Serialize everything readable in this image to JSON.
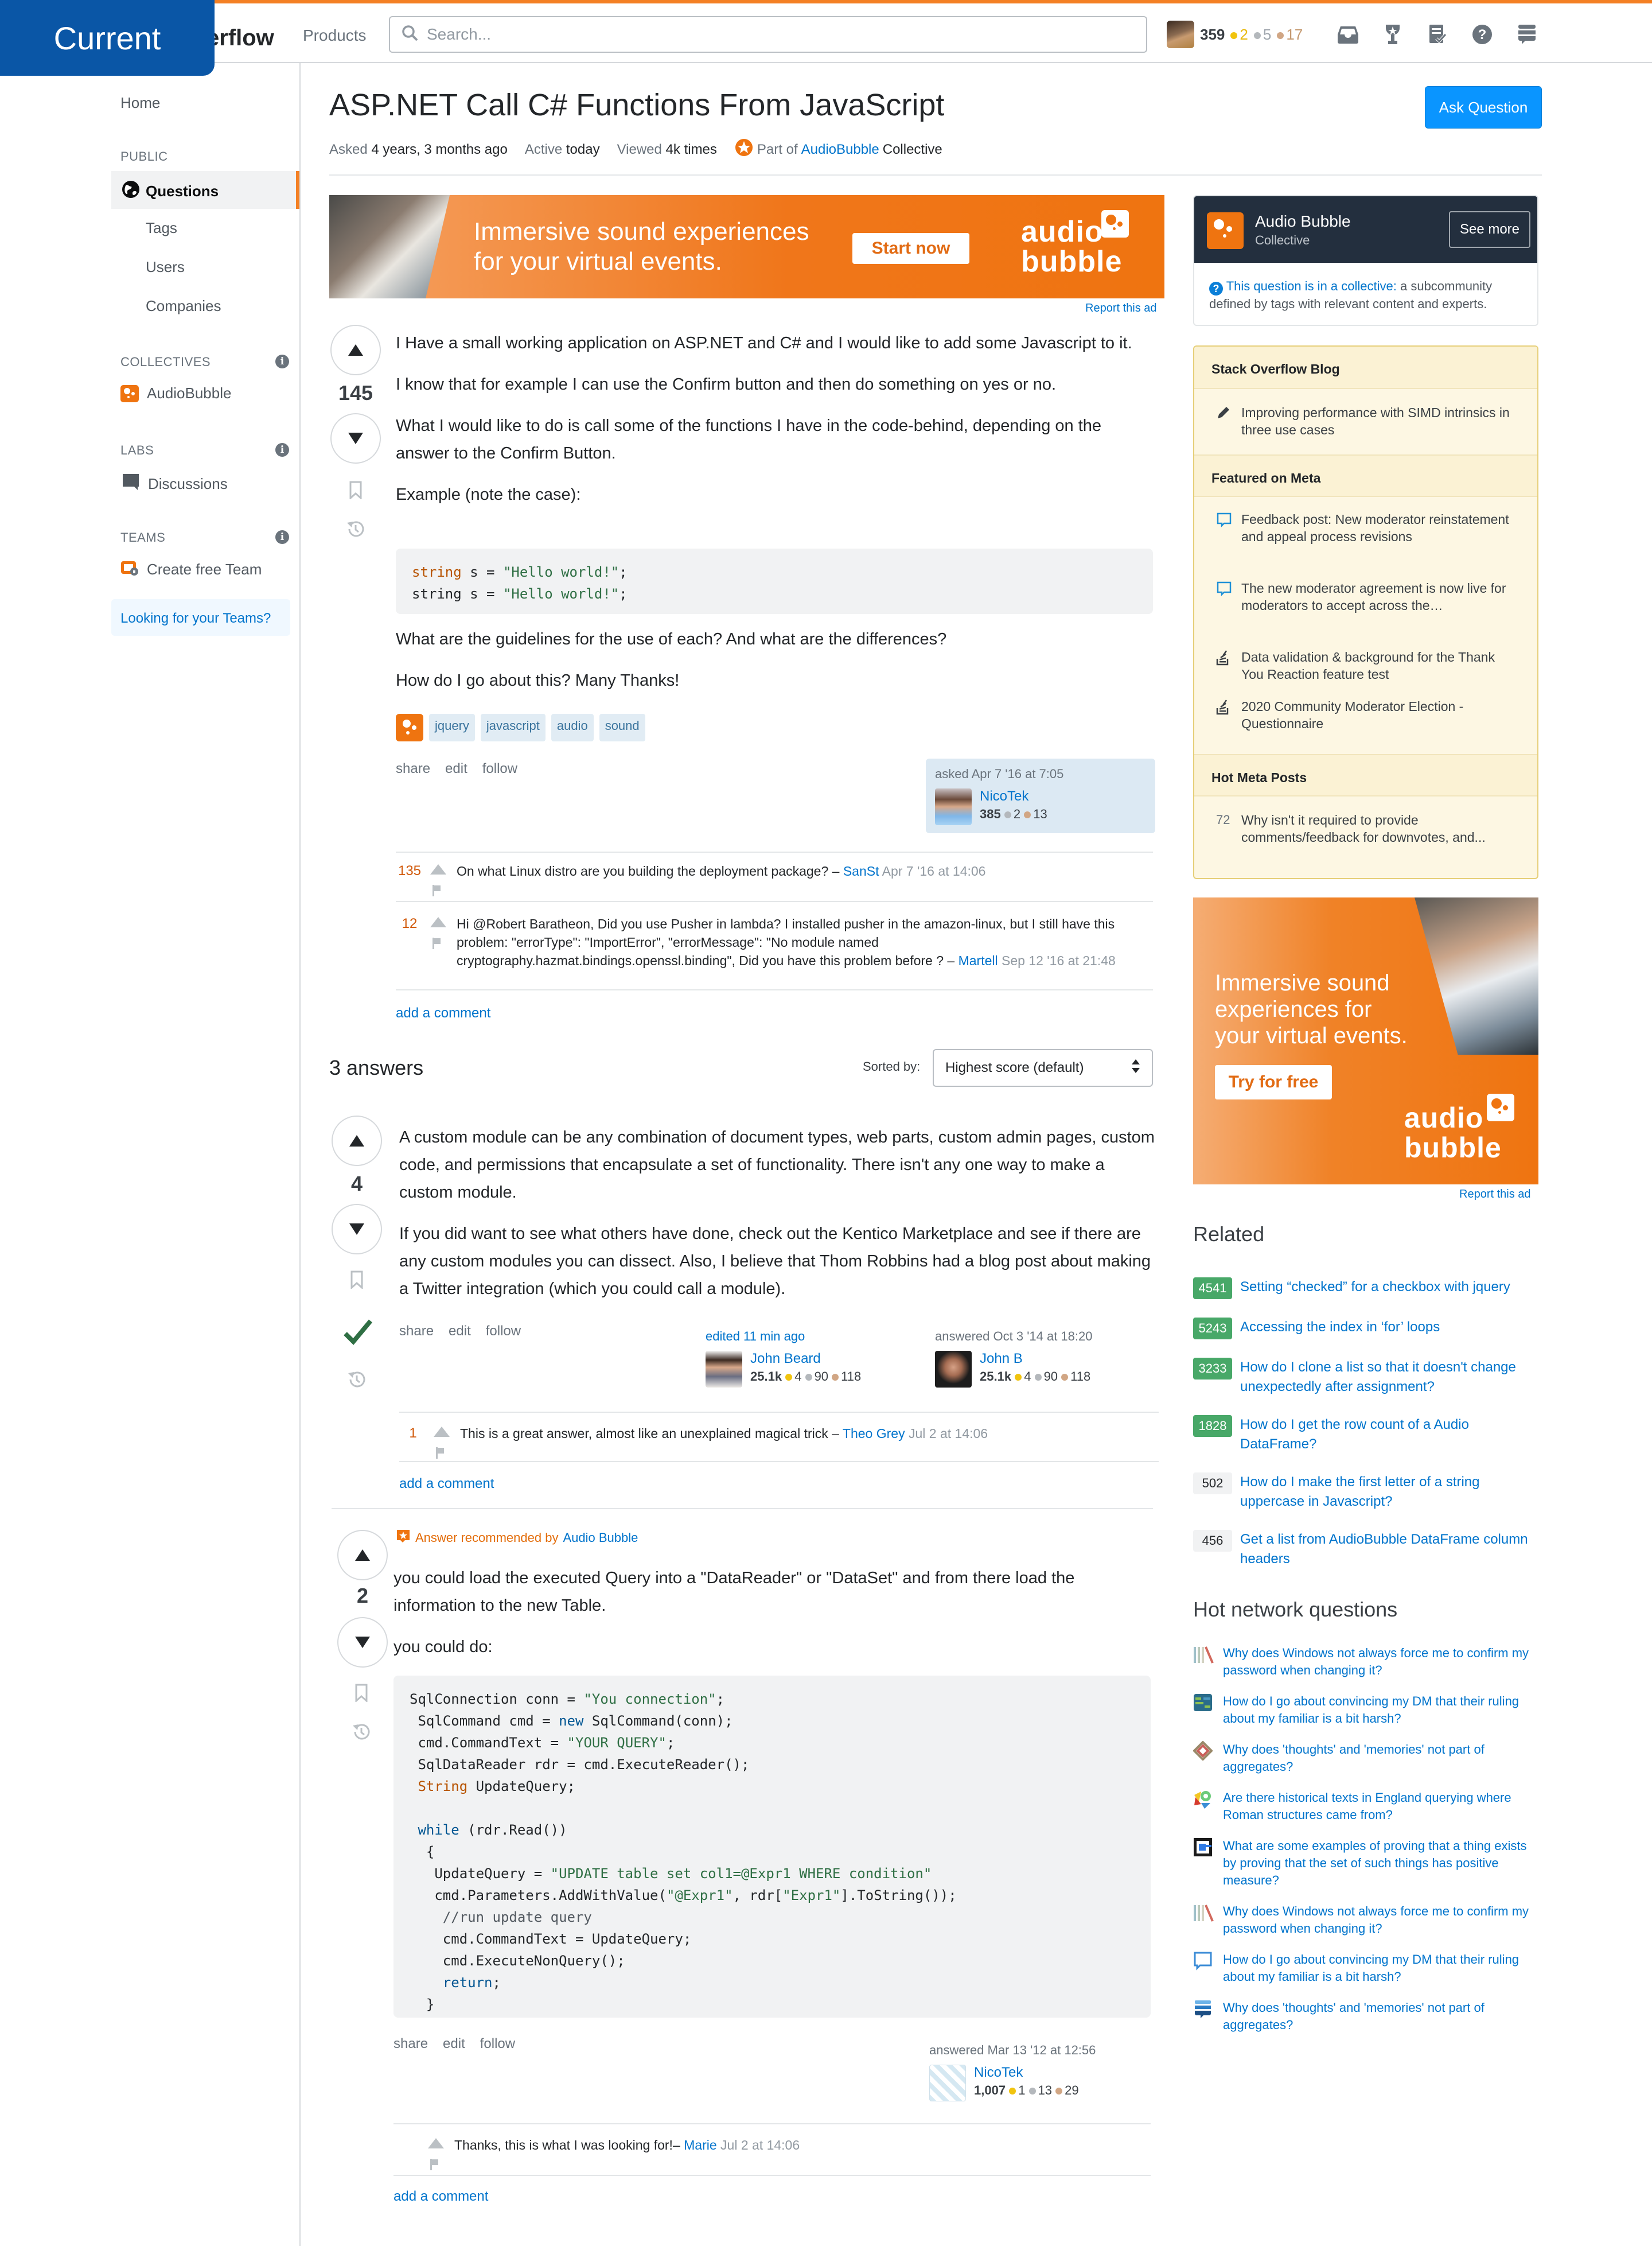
{
  "overlay_badge": "Current",
  "topbar": {
    "logo_text": "erflow",
    "products": "Products",
    "search_placeholder": "Search...",
    "user": {
      "reputation": "359",
      "gold": "2",
      "silver": "5",
      "bronze": "17"
    },
    "icons": [
      "inbox-icon",
      "achievements-icon",
      "review-icon",
      "help-icon",
      "site-switcher-icon"
    ]
  },
  "sidebar": {
    "home": "Home",
    "public_label": "PUBLIC",
    "items": [
      {
        "label": "Questions",
        "active": true
      },
      {
        "label": "Tags"
      },
      {
        "label": "Users"
      },
      {
        "label": "Companies"
      }
    ],
    "collectives_label": "COLLECTIVES",
    "collective_item": "AudioBubble",
    "labs_label": "LABS",
    "labs_item": "Discussions",
    "teams_label": "TEAMS",
    "teams_item": "Create free Team",
    "teams_box": "Looking for your Teams?"
  },
  "question": {
    "title": "ASP.NET Call C# Functions From JavaScript",
    "ask_button": "Ask Question",
    "meta": {
      "asked_label": "Asked",
      "asked_value": "4 years, 3 months ago",
      "active_label": "Active",
      "active_value": "today",
      "viewed_label": "Viewed",
      "viewed_value": "4k times",
      "part_of": "Part of",
      "collective_link": "AudioBubble",
      "collective_suffix": "Collective"
    },
    "score": "145",
    "paragraphs": [
      "I Have a small working application on ASP.NET and C# and I would like to add some Javascript to it.",
      "I know that for example I can use the Confirm button and then do something on yes or no.",
      "What I would like to do is call some of the functions I have in the code-behind, depending on the answer to the Confirm Button.",
      "Example (note the case):"
    ],
    "code_lines": [
      [
        {
          "t": "string",
          "c": "type"
        },
        {
          "t": " s = ",
          "c": ""
        },
        {
          "t": "\"Hello world!\"",
          "c": "str"
        },
        {
          "t": ";",
          "c": ""
        }
      ],
      [
        {
          "t": "string s = ",
          "c": ""
        },
        {
          "t": "\"Hello world!\"",
          "c": "str"
        },
        {
          "t": ";",
          "c": ""
        }
      ]
    ],
    "paragraphs_after": [
      "What are the guidelines for the use of each? And what are the differences?",
      "How do I go about this? Many Thanks!"
    ],
    "tags": [
      "jquery",
      "javascript",
      "audio",
      "sound"
    ],
    "menu": [
      "share",
      "edit",
      "follow"
    ],
    "owner": {
      "when": "asked Apr 7 '16 at 7:05",
      "name": "NicoTek",
      "rep": "385",
      "silver": "2",
      "bronze": "13"
    },
    "comments": [
      {
        "score": "135",
        "text": "On what Linux distro are you building the deployment package? –",
        "user": "SanSt",
        "date": "Apr 7 '16 at 14:06"
      },
      {
        "score": "12",
        "text": "Hi @Robert Baratheon, Did you use Pusher in lambda? I installed pusher in the amazon-linux, but I still have this problem: \"errorType\": \"ImportError\",   \"errorMessage\": \"No module named cryptography.hazmat.bindings.openssl.binding\", Did you have this problem before ? –",
        "user": "Martell",
        "date": "Sep 12 '16 at 21:48"
      }
    ],
    "add_comment": "add a comment"
  },
  "answers_header": {
    "count": "3 answers",
    "sorted_by": "Sorted by:",
    "sort_value": "Highest score (default)"
  },
  "answers": [
    {
      "score": "4",
      "accepted": true,
      "paragraphs": [
        "A custom module can be any combination of document types, web parts, custom admin pages, custom code, and permissions that encapsulate a set of functionality. There isn't any one way to make a custom module.",
        "If you did want to see what others have done, check out the Kentico Marketplace and see if there are any custom modules you can dissect. Also, I believe that Thom Robbins had a blog post about making a Twitter integration (which you could call a module)."
      ],
      "menu": [
        "share",
        "edit",
        "follow"
      ],
      "editor": {
        "when": "edited 11 min ago",
        "name": "John Beard",
        "rep": "25.1k",
        "gold": "4",
        "silver": "90",
        "bronze": "118"
      },
      "author": {
        "when": "answered Oct 3 '14 at 18:20",
        "name": "John B",
        "rep": "25.1k",
        "gold": "4",
        "silver": "90",
        "bronze": "118"
      },
      "comments": [
        {
          "score": "1",
          "text": "This is a great answer, almost like an unexplained magical trick –",
          "user": "Theo Grey",
          "date": "Jul 2 at 14:06"
        }
      ],
      "add_comment": "add a comment"
    },
    {
      "score": "2",
      "recommended_label": "Answer recommended by",
      "recommended_by": "Audio Bubble",
      "paragraphs": [
        "you could load the executed Query into a \"DataReader\" or \"DataSet\" and from there load the information to the new Table.",
        "you could do:"
      ],
      "code_lines": [
        [
          {
            "t": "SqlConnection conn = ",
            "c": ""
          },
          {
            "t": "\"You connection\"",
            "c": "str"
          },
          {
            "t": ";",
            "c": ""
          }
        ],
        [
          {
            "t": " SqlCommand cmd = ",
            "c": ""
          },
          {
            "t": "new",
            "c": "key"
          },
          {
            "t": " SqlCommand(conn);",
            "c": ""
          }
        ],
        [
          {
            "t": " cmd.CommandText = ",
            "c": ""
          },
          {
            "t": "\"YOUR QUERY\"",
            "c": "str"
          },
          {
            "t": ";",
            "c": ""
          }
        ],
        [
          {
            "t": " SqlDataReader rdr = cmd.ExecuteReader();",
            "c": ""
          }
        ],
        [
          {
            "t": " ",
            "c": ""
          },
          {
            "t": "String",
            "c": "type"
          },
          {
            "t": " UpdateQuery;",
            "c": ""
          }
        ],
        [
          {
            "t": "",
            "c": ""
          }
        ],
        [
          {
            "t": " ",
            "c": ""
          },
          {
            "t": "while",
            "c": "key"
          },
          {
            "t": " (rdr.Read())",
            "c": ""
          }
        ],
        [
          {
            "t": "  {",
            "c": ""
          }
        ],
        [
          {
            "t": "   UpdateQuery = ",
            "c": ""
          },
          {
            "t": "\"UPDATE table set col1=@Expr1 WHERE condition\"",
            "c": "str"
          }
        ],
        [
          {
            "t": "   cmd.Parameters.AddWithValue(",
            "c": ""
          },
          {
            "t": "\"@Expr1\"",
            "c": "str"
          },
          {
            "t": ", rdr[",
            "c": ""
          },
          {
            "t": "\"Expr1\"",
            "c": "str"
          },
          {
            "t": "].ToString());",
            "c": ""
          }
        ],
        [
          {
            "t": "    //run update query",
            "c": "com"
          }
        ],
        [
          {
            "t": "    cmd.CommandText = UpdateQuery;",
            "c": ""
          }
        ],
        [
          {
            "t": "    cmd.ExecuteNonQuery();",
            "c": ""
          }
        ],
        [
          {
            "t": "    ",
            "c": ""
          },
          {
            "t": "return",
            "c": "key"
          },
          {
            "t": ";",
            "c": ""
          }
        ],
        [
          {
            "t": "  }",
            "c": ""
          }
        ]
      ],
      "menu": [
        "share",
        "edit",
        "follow"
      ],
      "author": {
        "when": "answered Mar 13 '12 at 12:56",
        "name": "NicoTek",
        "rep": "1,007",
        "gold": "1",
        "silver": "13",
        "bronze": "29"
      },
      "comments": [
        {
          "score": "",
          "text": "Thanks, this is what I was looking for!–",
          "user": "Marie",
          "date": "Jul 2 at 14:06"
        }
      ],
      "add_comment": "add a comment"
    }
  ],
  "ads": {
    "banner": {
      "headline_1": "Immersive sound experiences",
      "headline_2": "for your virtual events.",
      "cta": "Start now",
      "brand_1": "audio",
      "brand_2": "bubble",
      "report": "Report this ad"
    },
    "square": {
      "headline_1": "Immersive sound",
      "headline_2": "experiences for",
      "headline_3": "your virtual events.",
      "cta": "Try for free",
      "brand_1": "audio",
      "brand_2": "bubble",
      "report": "Report this ad"
    }
  },
  "collective_card": {
    "name": "Audio Bubble",
    "subtitle": "Collective",
    "see_more": "See more",
    "note_link": "This question is in a collective:",
    "note_text": "a subcommunity defined by tags with relevant content and experts."
  },
  "blog_widget": {
    "blog_title": "Stack Overflow Blog",
    "blog_items": [
      "Improving performance with SIMD intrinsics in three use cases"
    ],
    "meta_title": "Featured on Meta",
    "meta_items": [
      {
        "icon": "chat-bubble-icon",
        "text": "Feedback post: New moderator reinstatement and appeal process revisions"
      },
      {
        "icon": "chat-bubble-icon",
        "text": "The new moderator agreement is now live for moderators to accept across the…"
      },
      {
        "icon": "stackoverflow-icon",
        "text": "Data validation & background for the Thank You Reaction feature test"
      },
      {
        "icon": "stackoverflow-icon",
        "text": "2020 Community Moderator Election - Questionnaire"
      }
    ],
    "hot_title": "Hot Meta Posts",
    "hot_items": [
      {
        "score": "72",
        "text": "Why isn't it required to provide comments/feedback for downvotes, and..."
      }
    ]
  },
  "related": {
    "title": "Related",
    "items": [
      {
        "score": "4541",
        "accepted": true,
        "text": "Setting “checked” for a checkbox with jquery"
      },
      {
        "score": "5243",
        "accepted": true,
        "text": "Accessing the index in ‘for’ loops"
      },
      {
        "score": "3233",
        "accepted": true,
        "text": "How do I clone a list so that it doesn't change unexpectedly after assignment?"
      },
      {
        "score": "1828",
        "accepted": true,
        "text": "How do I get the row count of a Audio DataFrame?"
      },
      {
        "score": "502",
        "accepted": false,
        "text": "How do I make the first letter of a string uppercase in Javascript?"
      },
      {
        "score": "456",
        "accepted": false,
        "text": "Get a list from AudioBubble DataFrame column headers"
      }
    ]
  },
  "hot_network": {
    "title": "Hot network questions",
    "items": [
      {
        "icon": "books-site-icon",
        "text": "Why does Windows not always force me to confirm my password when changing it?"
      },
      {
        "icon": "rpg-site-icon",
        "text": "How do I go about convincing my DM that their ruling about my familiar is a bit harsh?"
      },
      {
        "icon": "philosophy-site-icon",
        "text": "Why does 'thoughts' and 'memories' not part of aggregates?"
      },
      {
        "icon": "history-site-icon",
        "text": "Are there historical texts in England querying where Roman structures came from?"
      },
      {
        "icon": "math-site-icon",
        "text": "What are some examples of proving that a thing exists by proving that the set of such things has positive measure?"
      },
      {
        "icon": "books-site-icon",
        "text": "Why does Windows not always force me to confirm my password when changing it?"
      },
      {
        "icon": "meta-site-icon",
        "text": "How do I go about convincing my DM that their ruling about my familiar is a bit harsh?"
      },
      {
        "icon": "stackexchange-site-icon",
        "text": "Why does 'thoughts' and 'memories' not part of aggregates?"
      }
    ]
  },
  "colors": {
    "accent": "#f48024",
    "link": "#0074cc",
    "ask_button": "#0a95ff",
    "accepted": "#2f6f44",
    "ad_orange": "#ef7410"
  }
}
